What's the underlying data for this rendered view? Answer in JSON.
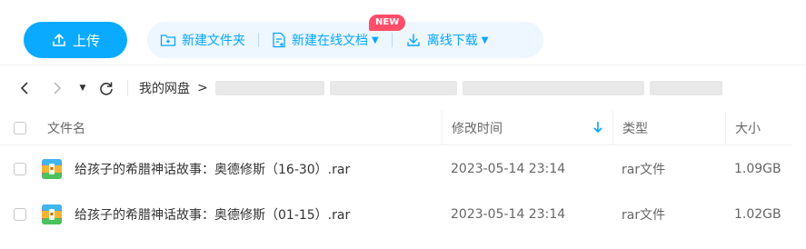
{
  "toolbar": {
    "upload_label": "上传",
    "new_folder_label": "新建文件夹",
    "new_online_doc_label": "新建在线文档",
    "new_badge": "NEW",
    "offline_download_label": "离线下载"
  },
  "nav": {
    "root_crumb": "我的网盘",
    "separator": ">"
  },
  "table": {
    "columns": [
      "文件名",
      "修改时间",
      "类型",
      "大小"
    ],
    "rows": [
      {
        "name": "给孩子的希腊神话故事：奥德修斯（16-30）.rar",
        "modified": "2023-05-14 23:14",
        "type": "rar文件",
        "size": "1.09GB"
      },
      {
        "name": "给孩子的希腊神话故事：奥德修斯（01-15）.rar",
        "modified": "2023-05-14 23:14",
        "type": "rar文件",
        "size": "1.02GB"
      }
    ]
  },
  "colors": {
    "accent": "#09aaff",
    "group_bg": "#eef6ff",
    "badge": "#ff4d6a"
  }
}
